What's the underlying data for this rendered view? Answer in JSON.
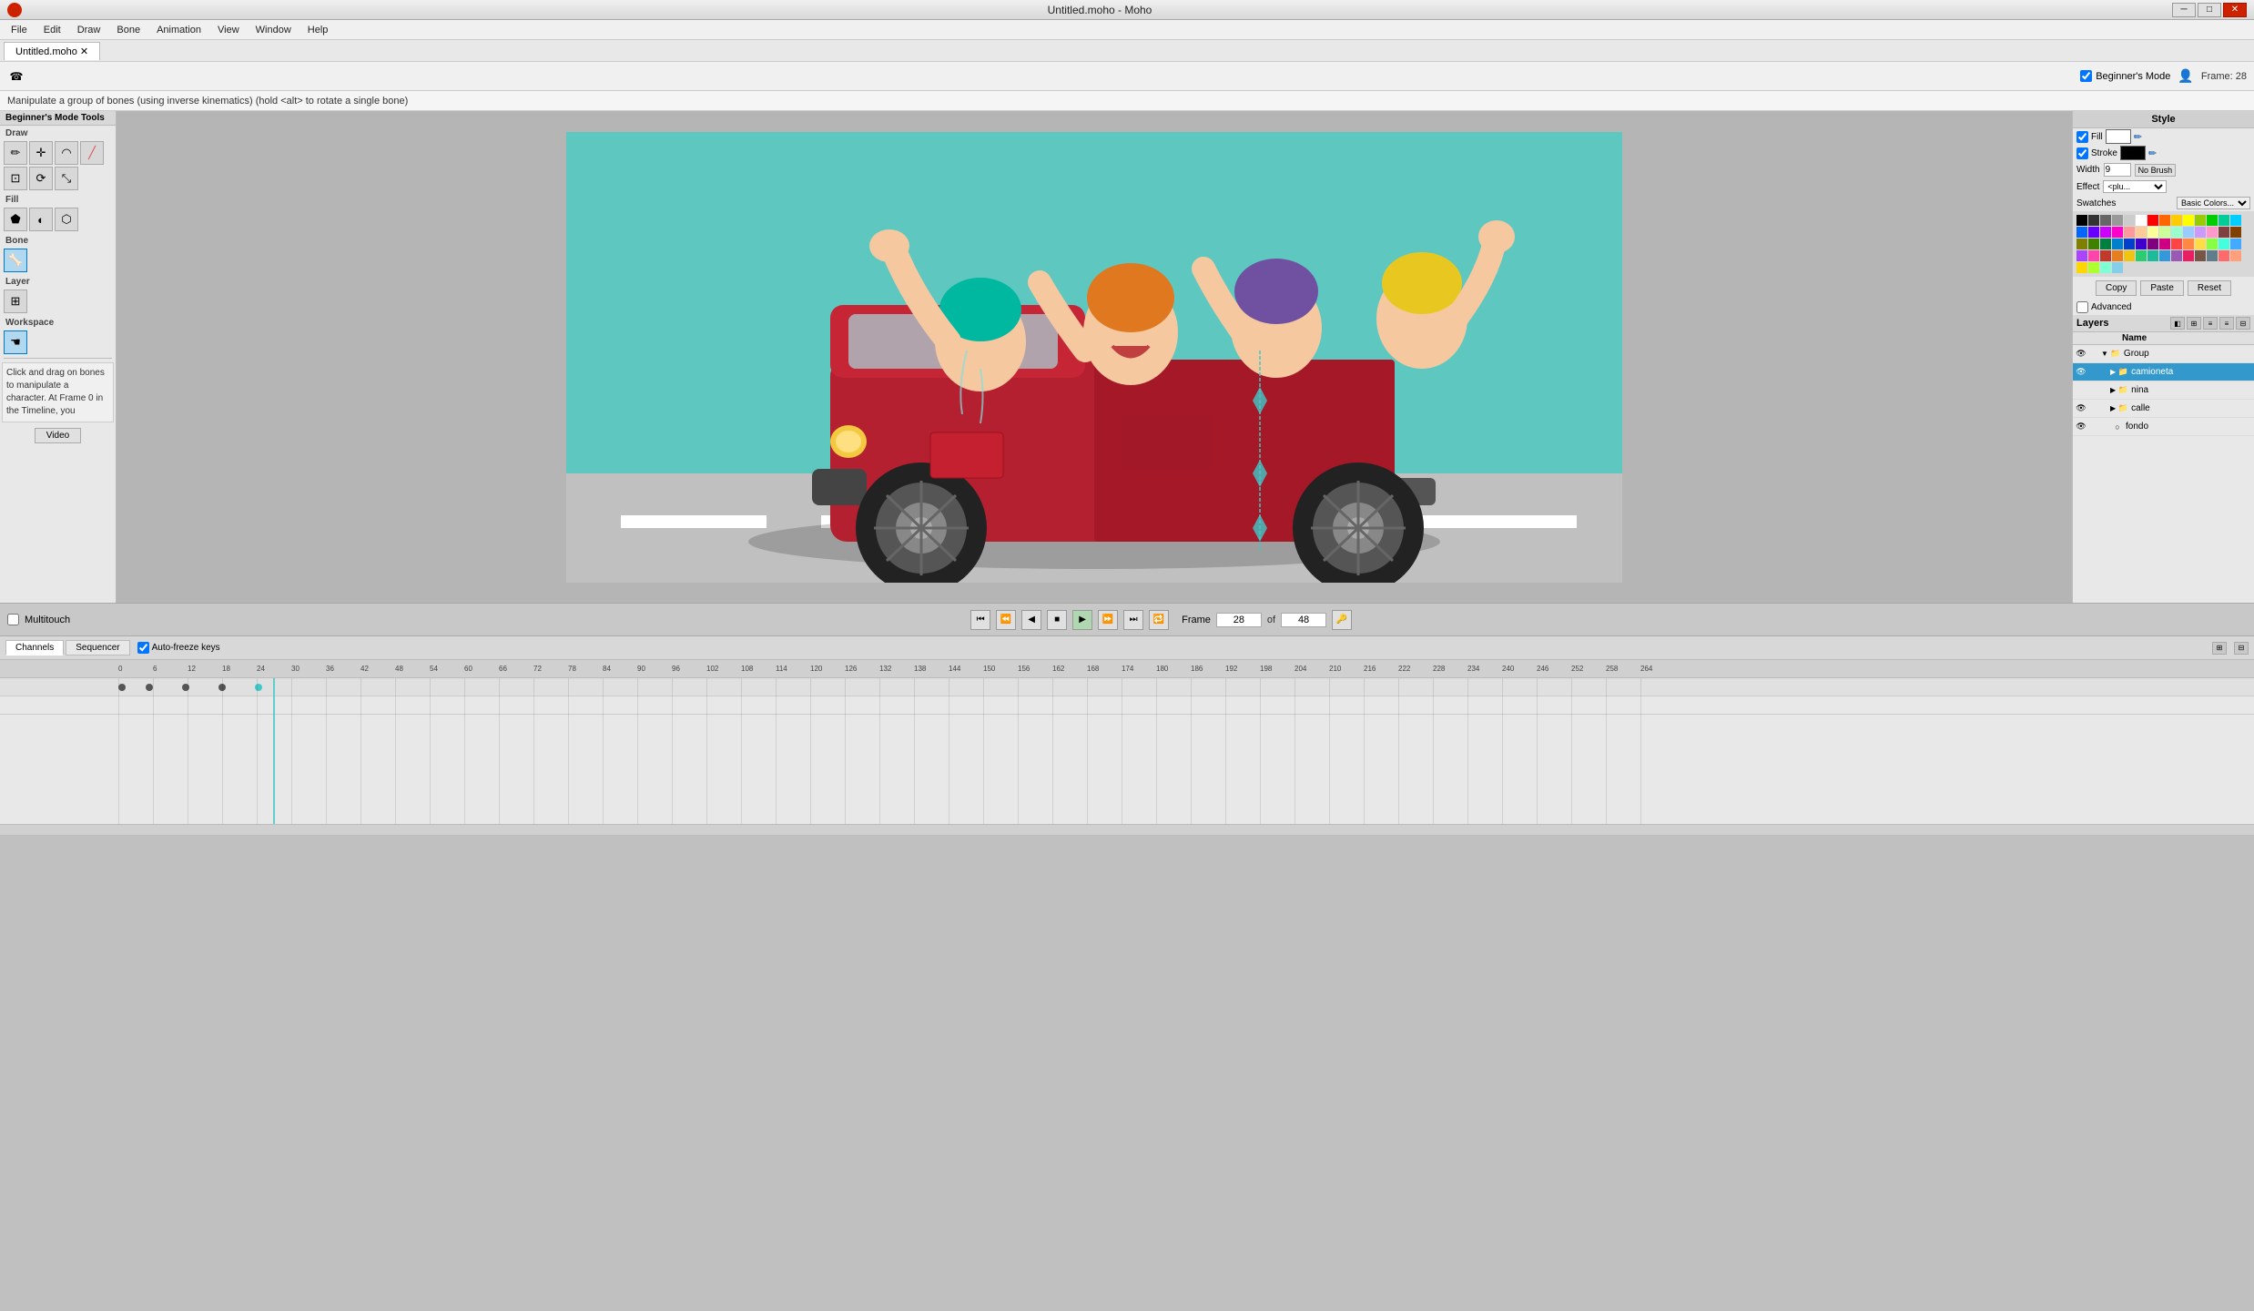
{
  "titlebar": {
    "title": "Untitled.moho - Moho",
    "logo": "moho-logo",
    "btns": [
      "minimize",
      "maximize",
      "close"
    ]
  },
  "menubar": {
    "items": [
      "File",
      "Edit",
      "Draw",
      "Bone",
      "Animation",
      "View",
      "Window",
      "Help"
    ]
  },
  "tab": {
    "label": "Untitled.moho ✕"
  },
  "toolbar": {
    "icon": "olo",
    "beginner_mode_label": "Beginner's Mode",
    "frame_label": "Frame: 28"
  },
  "statusbar": {
    "message": "Manipulate a group of bones (using inverse kinematics) (hold <alt> to rotate a single bone)"
  },
  "left_panel": {
    "beginner_tools": "Beginner's Mode Tools",
    "sections": [
      {
        "label": "Draw"
      },
      {
        "label": "Fill"
      },
      {
        "label": "Bone"
      },
      {
        "label": "Layer"
      },
      {
        "label": "Workspace"
      }
    ]
  },
  "info_text": "Click and drag on bones to manipulate a character. At Frame 0 in the Timeline, you",
  "video_btn": "Video",
  "right_panel": {
    "style_title": "Style",
    "fill_label": "Fill",
    "stroke_label": "Stroke",
    "width_label": "Width",
    "width_value": "9",
    "no_brush_label": "No Brush",
    "effect_label": "Effect",
    "effect_value": "<plu...",
    "swatches_label": "Swatches",
    "swatches_dropdown": "Basic Colors...",
    "copy_btn": "Copy",
    "paste_btn": "Paste",
    "reset_btn": "Reset",
    "advanced_label": "Advanced"
  },
  "layers_panel": {
    "title": "Layers",
    "name_col": "Name",
    "layers": [
      {
        "name": "Group",
        "type": "group",
        "indent": 0,
        "selected": false,
        "expanded": true
      },
      {
        "name": "camioneta",
        "type": "folder",
        "indent": 1,
        "selected": true,
        "expanded": false
      },
      {
        "name": "nina",
        "type": "folder",
        "indent": 1,
        "selected": false,
        "expanded": false
      },
      {
        "name": "calle",
        "type": "folder",
        "indent": 1,
        "selected": false,
        "expanded": false
      },
      {
        "name": "fondo",
        "type": "layer",
        "indent": 1,
        "selected": false,
        "expanded": false
      }
    ]
  },
  "transport": {
    "multitouch": "Multitouch",
    "frame_label": "Frame",
    "frame_value": "28",
    "of_label": "of",
    "total_frames": "48"
  },
  "timeline": {
    "tabs": [
      "Channels",
      "Sequencer"
    ],
    "auto_freeze_label": "Auto-freeze keys",
    "frame_numbers": [
      "0",
      "6",
      "12",
      "18",
      "24",
      "30",
      "36",
      "42",
      "48",
      "54",
      "60",
      "66",
      "72",
      "78",
      "84",
      "90",
      "96",
      "102",
      "108",
      "114",
      "120",
      "126",
      "132",
      "138",
      "144",
      "150",
      "156",
      "162",
      "168",
      "174",
      "180",
      "186",
      "192",
      "198",
      "204",
      "210",
      "216",
      "222",
      "228",
      "234",
      "240",
      "246",
      "252",
      "258",
      "264"
    ]
  },
  "colors": {
    "accent": "#3399cc",
    "bg_canvas": "#5ec8c0",
    "road": "#c0c0c0",
    "truck_red": "#b52030",
    "selected_layer": "#3399cc"
  },
  "swatches": [
    "#000000",
    "#333333",
    "#666666",
    "#999999",
    "#cccccc",
    "#ffffff",
    "#ff0000",
    "#ff6600",
    "#ffcc00",
    "#ffff00",
    "#99cc00",
    "#00cc00",
    "#00cc99",
    "#00ccff",
    "#0066ff",
    "#6600ff",
    "#cc00ff",
    "#ff00cc",
    "#ff9999",
    "#ffcc99",
    "#ffff99",
    "#ccff99",
    "#99ffcc",
    "#99ccff",
    "#cc99ff",
    "#ff99cc",
    "#804040",
    "#804000",
    "#808000",
    "#408000",
    "#008040",
    "#0080cc",
    "#0040cc",
    "#4000cc",
    "#800080",
    "#cc0080",
    "#ff4444",
    "#ff8844",
    "#ffdd44",
    "#88ff44",
    "#44ffdd",
    "#44aaff",
    "#aa44ff",
    "#ff44aa",
    "#c0392b",
    "#e67e22",
    "#f1c40f",
    "#2ecc71",
    "#1abc9c",
    "#3498db",
    "#9b59b6",
    "#e91e63",
    "#795548",
    "#607d8b",
    "#ff6b6b",
    "#ffa07a",
    "#ffd700",
    "#adff2f",
    "#7fffd4",
    "#87ceeb"
  ]
}
